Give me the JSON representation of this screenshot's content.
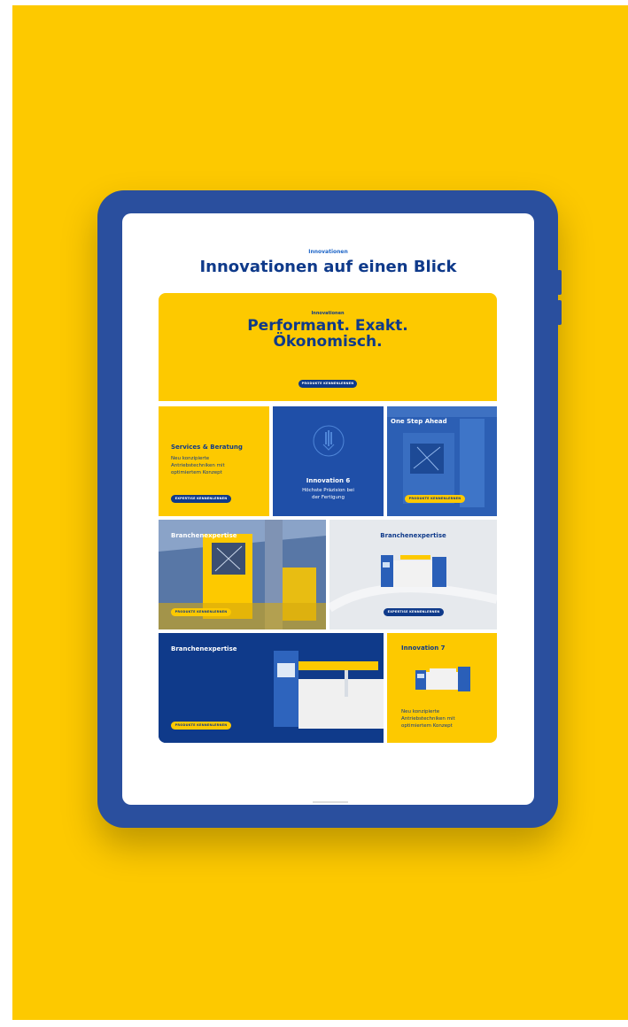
{
  "section": {
    "eyebrow": "Innovationen",
    "title": "Innovationen auf einen Blick"
  },
  "hero": {
    "kicker": "Innovationen",
    "headline_line1": "Performant. Exakt.",
    "headline_line2": "Ökonomisch.",
    "button": "PRODUKTE KENNENLERNEN"
  },
  "cards": {
    "services": {
      "title": "Services & Beratung",
      "text_line1": "Neu konzipierte",
      "text_line2": "Antriebstechniken mit",
      "text_line3": "optimiertem Konzept",
      "button": "EXPERTISE KENNENLERNEN"
    },
    "innovation6": {
      "title": "Innovation 6",
      "text_line1": "Höchste Präzision bei",
      "text_line2": "der Fertigung"
    },
    "one_step": {
      "title": "One Step Ahead",
      "button": "PRODUKTE KENNENLERNEN"
    },
    "branche1": {
      "title": "Branchenexpertise",
      "button": "PRODUKTE KENNENLERNEN"
    },
    "branche2": {
      "title": "Branchenexpertise",
      "button": "EXPERTISE KENNENLERNEN"
    },
    "branche3": {
      "title": "Branchenexpertise",
      "button": "PRODUKTE KENNENLERNEN"
    },
    "innovation7": {
      "title": "Innovation 7",
      "text_line1": "Neu konzipierte",
      "text_line2": "Antriebstechniken mit",
      "text_line3": "optimiertem Konzept"
    }
  },
  "colors": {
    "brand_yellow": "#fdc900",
    "brand_blue": "#0f3a8a",
    "accent_blue": "#1f66c8"
  }
}
